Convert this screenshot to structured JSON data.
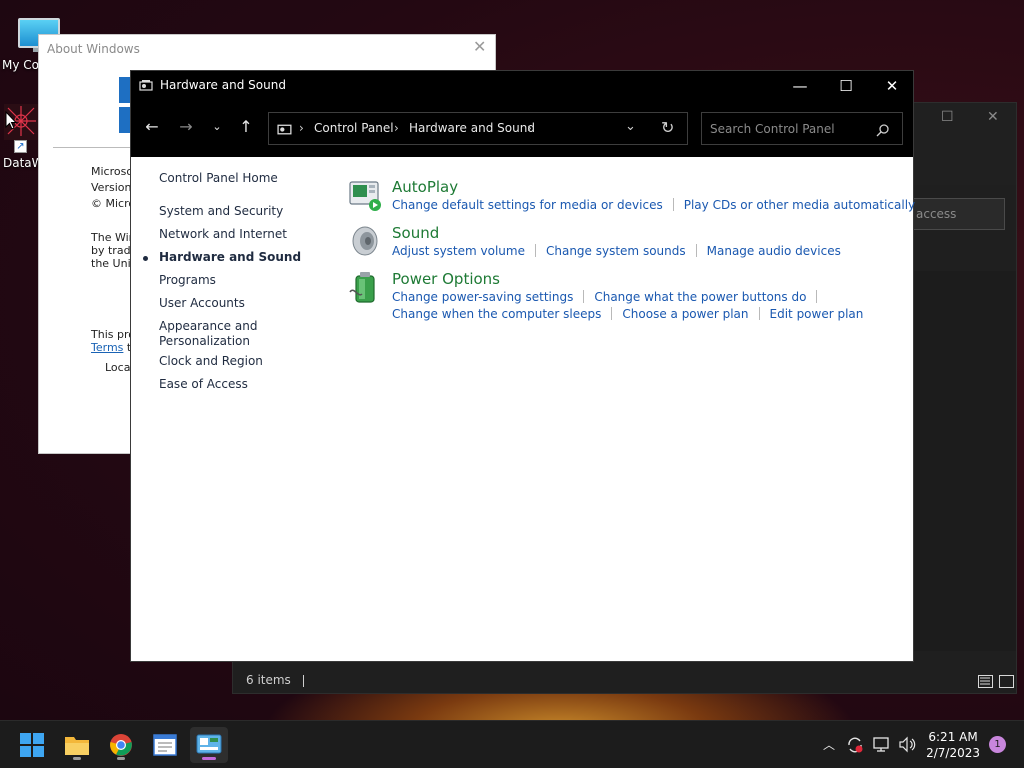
{
  "desktop": {
    "icons": [
      {
        "label": "My Co"
      },
      {
        "label": "DataW"
      }
    ]
  },
  "about_window": {
    "title": "About Windows",
    "lines": [
      "Microsof",
      "Version",
      "© Micros",
      "The Win",
      "by trade",
      "the Unit",
      "This pro",
      "Terms",
      "to",
      "Local"
    ]
  },
  "back_window": {
    "search_text": "access",
    "status_text": "6 items"
  },
  "cp": {
    "title": "Hardware and Sound",
    "breadcrumb": [
      "Control Panel",
      "Hardware and Sound"
    ],
    "search_placeholder": "Search Control Panel",
    "sidebar": {
      "home": "Control Panel Home",
      "items": [
        {
          "label": "System and Security"
        },
        {
          "label": "Network and Internet"
        },
        {
          "label": "Hardware and Sound",
          "current": true
        },
        {
          "label": "Programs"
        },
        {
          "label": "User Accounts"
        },
        {
          "label": "Appearance and"
        },
        {
          "label": "Personalization"
        },
        {
          "label": "Clock and Region"
        },
        {
          "label": "Ease of Access"
        }
      ]
    },
    "categories": [
      {
        "title": "AutoPlay",
        "icon": "autoplay-icon",
        "links": [
          [
            "Change default settings for media or devices",
            "Play CDs or other media automatically"
          ]
        ]
      },
      {
        "title": "Sound",
        "icon": "speaker-icon",
        "links": [
          [
            "Adjust system volume",
            "Change system sounds",
            "Manage audio devices"
          ]
        ]
      },
      {
        "title": "Power Options",
        "icon": "battery-icon",
        "links": [
          [
            "Change power-saving settings",
            "Change what the power buttons do"
          ],
          [
            "Change when the computer sleeps",
            "Choose a power plan",
            "Edit power plan"
          ]
        ]
      }
    ]
  },
  "taskbar": {
    "apps": [
      "start-icon",
      "file-explorer-icon",
      "chrome-icon",
      "notepad-icon",
      "control-panel-icon"
    ],
    "time": "6:21 AM",
    "date": "2/7/2023",
    "notification_count": "1"
  },
  "colors": {
    "accent_green": "#1e7a35",
    "link_blue": "#1a58b0"
  }
}
